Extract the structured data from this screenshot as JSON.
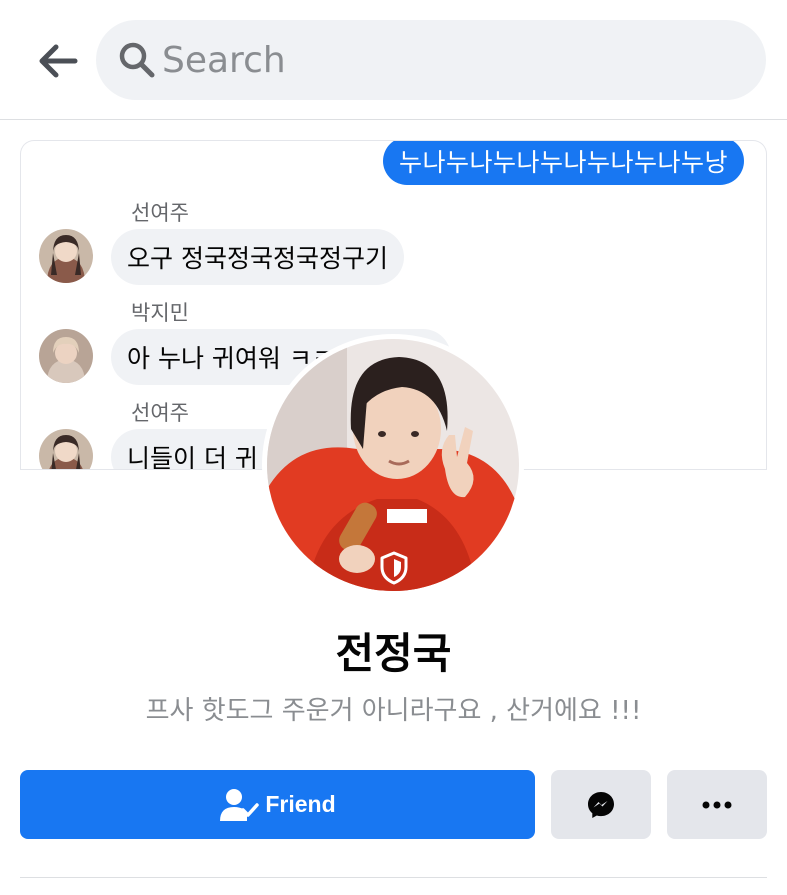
{
  "search": {
    "placeholder": "Search"
  },
  "icons": {
    "back": "arrow-left-icon",
    "search": "search-icon",
    "shield": "shield-icon",
    "friend": "person-check-icon",
    "messenger": "messenger-icon",
    "more": "more-dots-icon"
  },
  "colors": {
    "accent": "#1877f2",
    "bubble_gray": "#f0f2f5",
    "button_gray": "#e4e6eb",
    "muted_text": "#8a8d91"
  },
  "cover_chat": {
    "sent_message": "누나누나누나누나누나누나누낭",
    "messages": [
      {
        "sender": "선여주",
        "text": "오구 정국정국정국정구기"
      },
      {
        "sender": "박지민",
        "text": "아 누나 귀여워 ㅋㅋ"
      },
      {
        "sender": "선여주",
        "text": "니들이 더 귀"
      }
    ]
  },
  "profile": {
    "name": "전정국",
    "bio": "프사 핫도그 주운거 아니라구요 , 산거에요 !!!"
  },
  "actions": {
    "friend_label": "Friend"
  }
}
